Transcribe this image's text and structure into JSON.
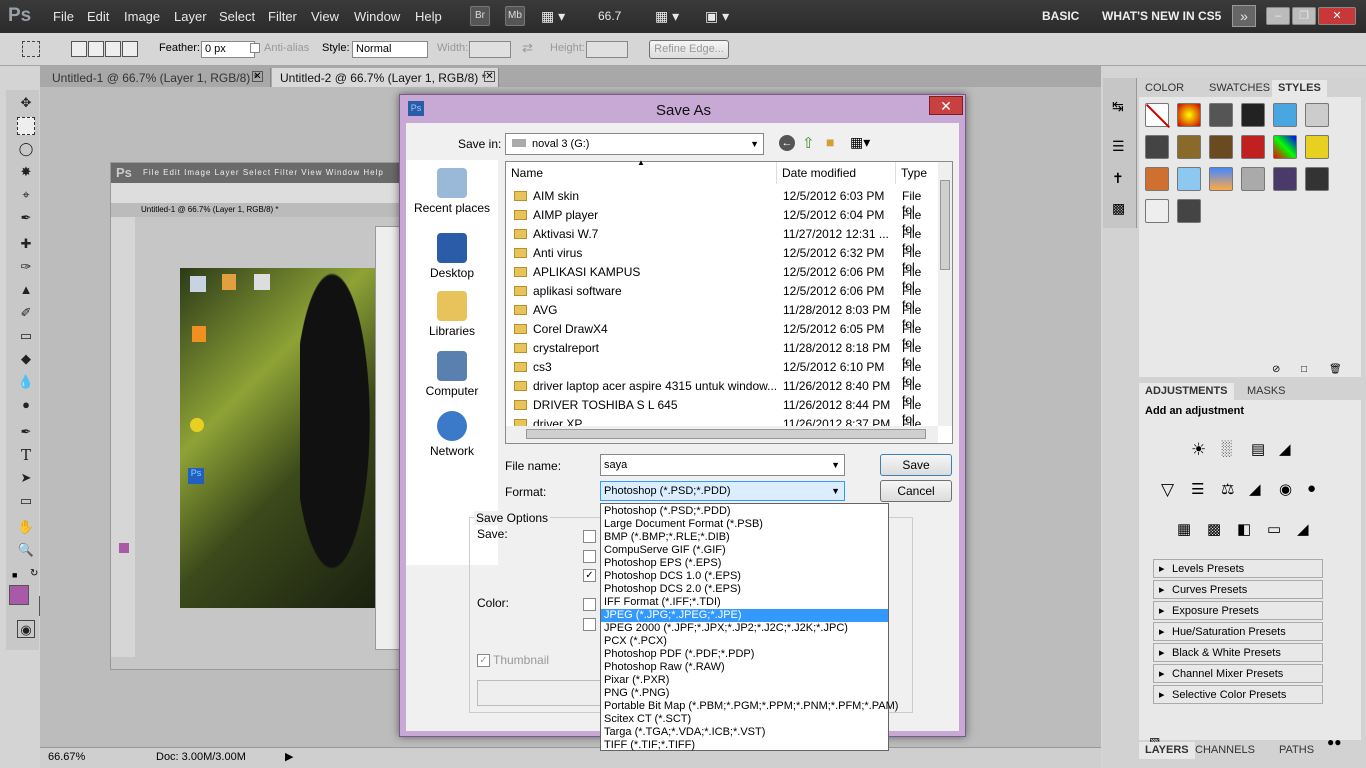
{
  "app": {
    "logo": "Ps",
    "menus": [
      "File",
      "Edit",
      "Image",
      "Layer",
      "Select",
      "Filter",
      "View",
      "Window",
      "Help"
    ],
    "zoom": "66.7",
    "workspace": "BASIC",
    "whatsnew": "WHAT'S NEW IN CS5",
    "br": "Br",
    "mb": "Mb"
  },
  "options": {
    "feather_label": "Feather:",
    "feather_value": "0 px",
    "antialias": "Anti-alias",
    "style_label": "Style:",
    "style_value": "Normal",
    "width_label": "Width:",
    "height_label": "Height:",
    "refine": "Refine Edge..."
  },
  "tabs": [
    "Untitled-1 @ 66.7% (Layer 1, RGB/8) *",
    "Untitled-2 @ 66.7% (Layer 1, RGB/8) *"
  ],
  "status": {
    "zoom": "66.67%",
    "doc": "Doc: 3.00M/3.00M"
  },
  "panels": {
    "tabs1": [
      "COLOR",
      "SWATCHES",
      "STYLES"
    ],
    "tabs2": [
      "ADJUSTMENTS",
      "MASKS"
    ],
    "add": "Add an adjustment",
    "presets": [
      "Levels Presets",
      "Curves Presets",
      "Exposure Presets",
      "Hue/Saturation Presets",
      "Black & White Presets",
      "Channel Mixer Presets",
      "Selective Color Presets"
    ],
    "tabs3": [
      "LAYERS",
      "CHANNELS",
      "PATHS"
    ]
  },
  "dialog": {
    "title": "Save As",
    "savein_label": "Save in:",
    "savein_value": "noval 3 (G:)",
    "places": [
      "Recent places",
      "Desktop",
      "Libraries",
      "Computer",
      "Network"
    ],
    "cols": [
      "Name",
      "Date modified",
      "Type"
    ],
    "files": [
      {
        "name": "AIM skin",
        "date": "12/5/2012 6:03 PM",
        "type": "File fol"
      },
      {
        "name": "AIMP player",
        "date": "12/5/2012 6:04 PM",
        "type": "File fol"
      },
      {
        "name": "Aktivasi W.7",
        "date": "11/27/2012 12:31 ...",
        "type": "File fol"
      },
      {
        "name": "Anti virus",
        "date": "12/5/2012 6:32 PM",
        "type": "File fol"
      },
      {
        "name": "APLIKASI KAMPUS",
        "date": "12/5/2012 6:06 PM",
        "type": "File fol"
      },
      {
        "name": "aplikasi software",
        "date": "12/5/2012 6:06 PM",
        "type": "File fol"
      },
      {
        "name": "AVG",
        "date": "11/28/2012 8:03 PM",
        "type": "File fol"
      },
      {
        "name": "Corel DrawX4",
        "date": "12/5/2012 6:05 PM",
        "type": "File fol"
      },
      {
        "name": "crystalreport",
        "date": "11/28/2012 8:18 PM",
        "type": "File fol"
      },
      {
        "name": "cs3",
        "date": "12/5/2012 6:10 PM",
        "type": "File fol"
      },
      {
        "name": "driver laptop acer aspire 4315 untuk window...",
        "date": "11/26/2012 8:40 PM",
        "type": "File fol"
      },
      {
        "name": "DRIVER TOSHIBA S L 645",
        "date": "11/26/2012 8:44 PM",
        "type": "File fol"
      },
      {
        "name": "driver XP",
        "date": "11/26/2012 8:37 PM",
        "type": "File fol"
      }
    ],
    "filename_label": "File name:",
    "filename_value": "saya",
    "format_label": "Format:",
    "format_value": "Photoshop (*.PSD;*.PDD)",
    "save": "Save",
    "cancel": "Cancel",
    "saveoptions": "Save Options",
    "save_label": "Save:",
    "color_label": "Color:",
    "thumbnail": "Thumbnail",
    "formats": [
      "Photoshop (*.PSD;*.PDD)",
      "Large Document Format (*.PSB)",
      "BMP (*.BMP;*.RLE;*.DIB)",
      "CompuServe GIF (*.GIF)",
      "Photoshop EPS (*.EPS)",
      "Photoshop DCS 1.0 (*.EPS)",
      "Photoshop DCS 2.0 (*.EPS)",
      "IFF Format (*.IFF;*.TDI)",
      "JPEG (*.JPG;*.JPEG;*.JPE)",
      "JPEG 2000 (*.JPF;*.JPX;*.JP2;*.J2C;*.J2K;*.JPC)",
      "PCX (*.PCX)",
      "Photoshop PDF (*.PDF;*.PDP)",
      "Photoshop Raw (*.RAW)",
      "Pixar (*.PXR)",
      "PNG (*.PNG)",
      "Portable Bit Map (*.PBM;*.PGM;*.PPM;*.PNM;*.PFM;*.PAM)",
      "Scitex CT (*.SCT)",
      "Targa (*.TGA;*.VDA;*.ICB;*.VST)",
      "TIFF (*.TIF;*.TIFF)"
    ],
    "selected_format_index": 8
  },
  "colors": {
    "fg": "#a85aa8",
    "selection": "#3399ff"
  }
}
